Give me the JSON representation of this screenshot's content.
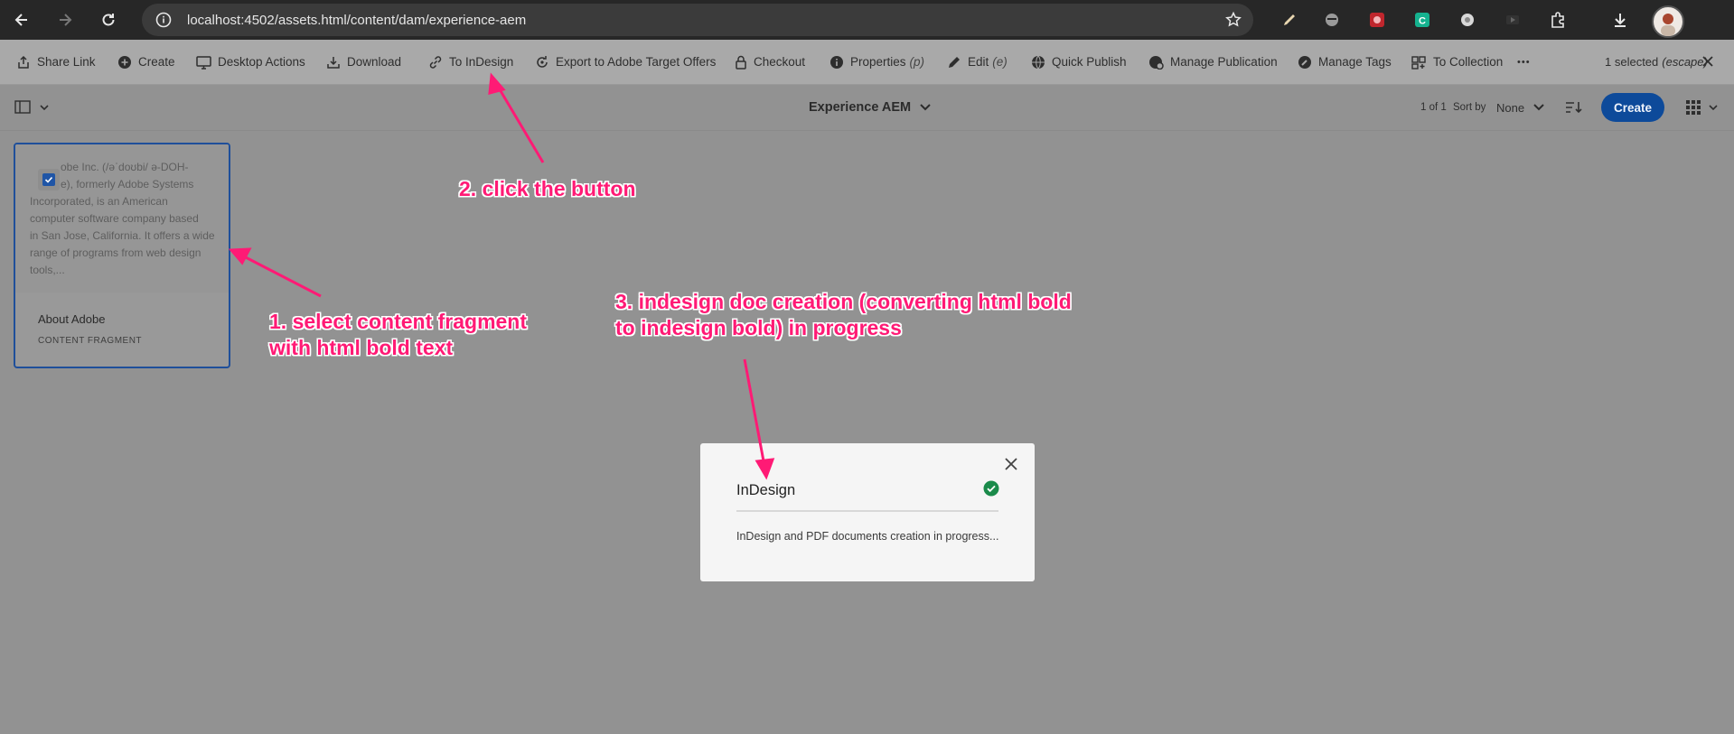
{
  "browser": {
    "url": "localhost:4502/assets.html/content/dam/experience-aem"
  },
  "actions": {
    "share_link": "Share Link",
    "create": "Create",
    "desktop_actions": "Desktop Actions",
    "download": "Download",
    "to_indesign": "To InDesign",
    "export_target": "Export to Adobe Target Offers",
    "checkout": "Checkout",
    "properties": "Properties",
    "properties_shortcut": "(p)",
    "edit": "Edit",
    "edit_shortcut": "(e)",
    "quick_publish": "Quick Publish",
    "manage_publication": "Manage Publication",
    "manage_tags": "Manage Tags",
    "to_collection": "To Collection",
    "more": "•••",
    "selected": "1 selected",
    "selected_hint": "(escape)"
  },
  "toolbar": {
    "title": "Experience AEM",
    "count": "1 of 1",
    "sort_by_label": "Sort by",
    "sort_by_value": "None",
    "create_button": "Create"
  },
  "card": {
    "preview_lines": [
      "obe Inc. (/əˈdoʊbi/ ə-DOH-",
      "e), formerly Adobe Systems",
      "Incorporated, is an American",
      "computer software company based",
      "in San Jose, California. It offers a wide",
      "range of programs from web design",
      "tools,..."
    ],
    "title": "About Adobe",
    "type": "CONTENT FRAGMENT"
  },
  "dialog": {
    "title": "InDesign",
    "message": "InDesign and PDF documents creation in progress..."
  },
  "annotations": {
    "step1_line1": "1. select content fragment",
    "step1_line2": "with html bold text",
    "step2": "2. click the button",
    "step3_line1": "3. indesign doc creation (converting html bold",
    "step3_line2": "to indesign bold) in progress"
  },
  "colors": {
    "annotation": "#ff1a75",
    "accent_blue": "#0d4a9a",
    "success_green": "#1a8a4a"
  }
}
